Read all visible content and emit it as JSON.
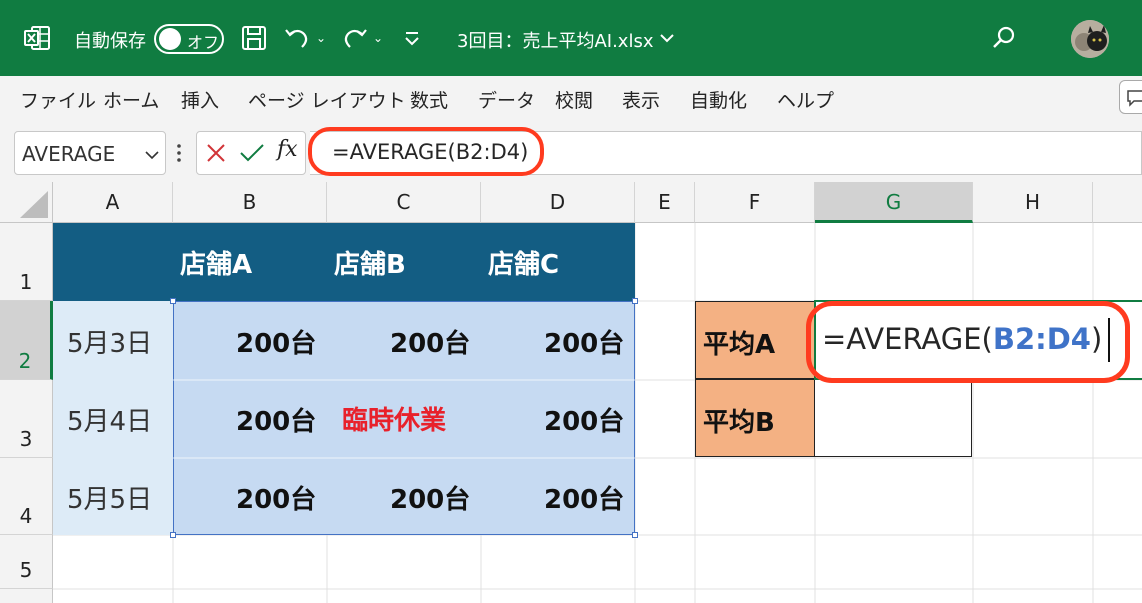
{
  "titlebar": {
    "autosave_label": "自動保存",
    "autosave_state": "オフ",
    "file_name": "3回目：売上平均AI.xlsx"
  },
  "ribbon": {
    "tabs": [
      "ファイル",
      "ホーム",
      "挿入",
      "ページ レイアウト",
      "数式",
      "データ",
      "校閲",
      "表示",
      "自動化",
      "ヘルプ"
    ]
  },
  "formula_bar": {
    "name_box": "AVERAGE",
    "fx_label": "fx",
    "formula": "=AVERAGE(B2:D4)"
  },
  "sheet": {
    "columns": [
      "A",
      "B",
      "C",
      "D",
      "E",
      "F",
      "G",
      "H"
    ],
    "rows": [
      "1",
      "2",
      "3",
      "4",
      "5"
    ],
    "headers": [
      "店舗A",
      "店舗B",
      "店舗C"
    ],
    "dates": [
      "5月3日",
      "5月4日",
      "5月5日"
    ],
    "values": [
      [
        "200台",
        "200台",
        "200台"
      ],
      [
        "200台",
        "臨時休業",
        "200台"
      ],
      [
        "200台",
        "200台",
        "200台"
      ]
    ],
    "avg_labels": [
      "平均A",
      "平均B"
    ],
    "edit_prefix": "=AVERAGE(",
    "edit_ref": "B2:D4",
    "edit_suffix": ")"
  },
  "colors": {
    "excel_green": "#107c41",
    "header_fill": "#135d83",
    "date_fill": "#ddebf7",
    "selection_fill": "#c6daf2",
    "avg_label_fill": "#f4b183",
    "closed_text": "#e8212b",
    "highlight": "#ff3b1f",
    "ref_blue": "#3f73c8"
  }
}
